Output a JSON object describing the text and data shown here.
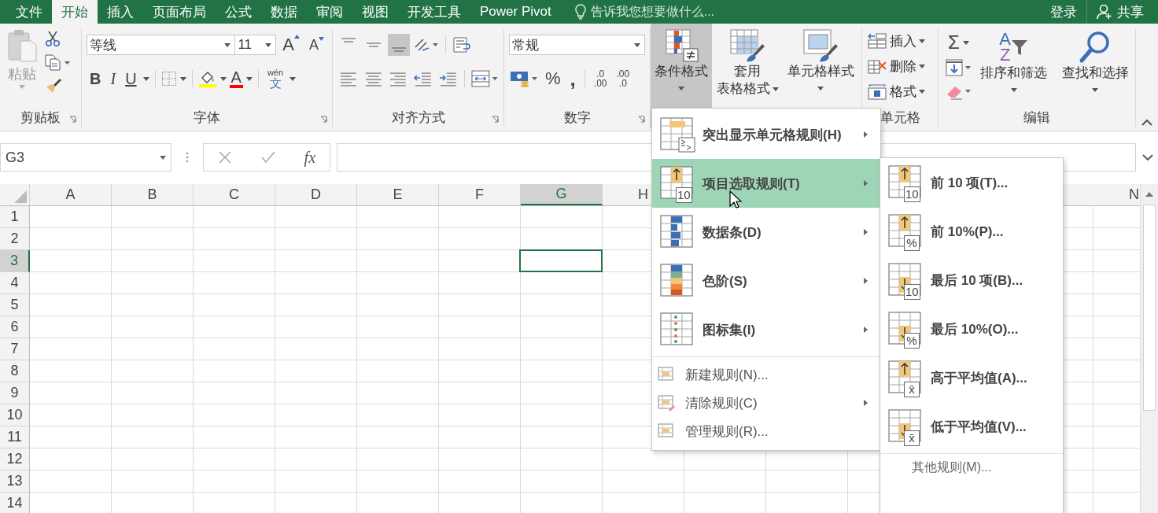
{
  "tabs": [
    {
      "label": "文件",
      "selected": false
    },
    {
      "label": "开始",
      "selected": true
    },
    {
      "label": "插入",
      "selected": false
    },
    {
      "label": "页面布局",
      "selected": false
    },
    {
      "label": "公式",
      "selected": false
    },
    {
      "label": "数据",
      "selected": false
    },
    {
      "label": "审阅",
      "selected": false
    },
    {
      "label": "视图",
      "selected": false
    },
    {
      "label": "开发工具",
      "selected": false
    },
    {
      "label": "Power Pivot",
      "selected": false
    }
  ],
  "tell_me": {
    "placeholder": "告诉我您想要做什么..."
  },
  "account": {
    "sign_in": "登录",
    "share": "共享"
  },
  "ribbon": {
    "clipboard": {
      "paste": "粘贴",
      "label": "剪贴板"
    },
    "font": {
      "name": "等线",
      "size": "11",
      "grow": "A",
      "shrink": "A",
      "bold": "B",
      "italic": "I",
      "underline": "U",
      "font_color": "A",
      "phonetic_top": "wén",
      "phonetic_bottom": "文",
      "label": "字体"
    },
    "alignment": {
      "label": "对齐方式"
    },
    "number": {
      "format": "常规",
      "percent": "%",
      "comma": ",",
      "increase_decimal": [
        ".0",
        ".00"
      ],
      "decrease_decimal": [
        ".00",
        ".0"
      ],
      "label": "数字"
    },
    "styles": [
      {
        "label": "条件格式",
        "pressed": true
      },
      {
        "label": "套用",
        "label_2": "表格格式",
        "pressed": false
      },
      {
        "label": "单元格样式",
        "pressed": false
      }
    ],
    "cells": {
      "items": [
        "插入",
        "删除",
        "格式"
      ],
      "label": "单元格"
    },
    "editing": {
      "sum": "Σ",
      "sort_letters": [
        "A",
        "Z"
      ],
      "sort": "排序和筛选",
      "find": "查找和选择",
      "label": "编辑"
    }
  },
  "formula_bar": {
    "name_box": "G3",
    "fx": "fx"
  },
  "columns": [
    {
      "label": "A",
      "selected": false
    },
    {
      "label": "B",
      "selected": false
    },
    {
      "label": "C",
      "selected": false
    },
    {
      "label": "D",
      "selected": false
    },
    {
      "label": "E",
      "selected": false
    },
    {
      "label": "F",
      "selected": false
    },
    {
      "label": "G",
      "selected": true
    },
    {
      "label": "H",
      "selected": false
    },
    {
      "label": "N",
      "selected": false
    }
  ],
  "rows": [
    {
      "label": "1",
      "selected": false
    },
    {
      "label": "2",
      "selected": false
    },
    {
      "label": "3",
      "selected": true
    },
    {
      "label": "4",
      "selected": false
    },
    {
      "label": "5",
      "selected": false
    },
    {
      "label": "6",
      "selected": false
    },
    {
      "label": "7",
      "selected": false
    },
    {
      "label": "8",
      "selected": false
    },
    {
      "label": "9",
      "selected": false
    },
    {
      "label": "10",
      "selected": false
    },
    {
      "label": "11",
      "selected": false
    },
    {
      "label": "12",
      "selected": false
    },
    {
      "label": "13",
      "selected": false
    },
    {
      "label": "14",
      "selected": false
    }
  ],
  "menu": {
    "items": [
      {
        "kind": "large",
        "label": "突出显示单元格规则(H)",
        "selected": false,
        "has_submenu": true
      },
      {
        "kind": "large",
        "label": "项目选取规则(T)",
        "badge": "10",
        "selected": true,
        "has_submenu": true
      },
      {
        "kind": "large",
        "label": "数据条(D)",
        "selected": false,
        "has_submenu": true
      },
      {
        "kind": "large",
        "label": "色阶(S)",
        "selected": false,
        "has_submenu": true
      },
      {
        "kind": "large",
        "label": "图标集(I)",
        "selected": false,
        "has_submenu": true
      },
      {
        "kind": "small",
        "label": "新建规则(N)...",
        "selected": false,
        "has_submenu": false
      },
      {
        "kind": "small",
        "label": "清除规则(C)",
        "selected": false,
        "has_submenu": true
      },
      {
        "kind": "small",
        "label": "管理规则(R)...",
        "selected": false,
        "has_submenu": false
      }
    ]
  },
  "submenu": {
    "items": [
      {
        "label": "前 10 项(T)...",
        "badge": "10"
      },
      {
        "label": "前 10%(P)...",
        "badge": "%"
      },
      {
        "label": "最后 10 项(B)...",
        "badge": "10"
      },
      {
        "label": "最后 10%(O)...",
        "badge": "%"
      },
      {
        "label": "高于平均值(A)...",
        "badge": "x̄"
      },
      {
        "label": "低于平均值(V)...",
        "badge": "x̄"
      }
    ],
    "more": "其他规则(M)..."
  }
}
